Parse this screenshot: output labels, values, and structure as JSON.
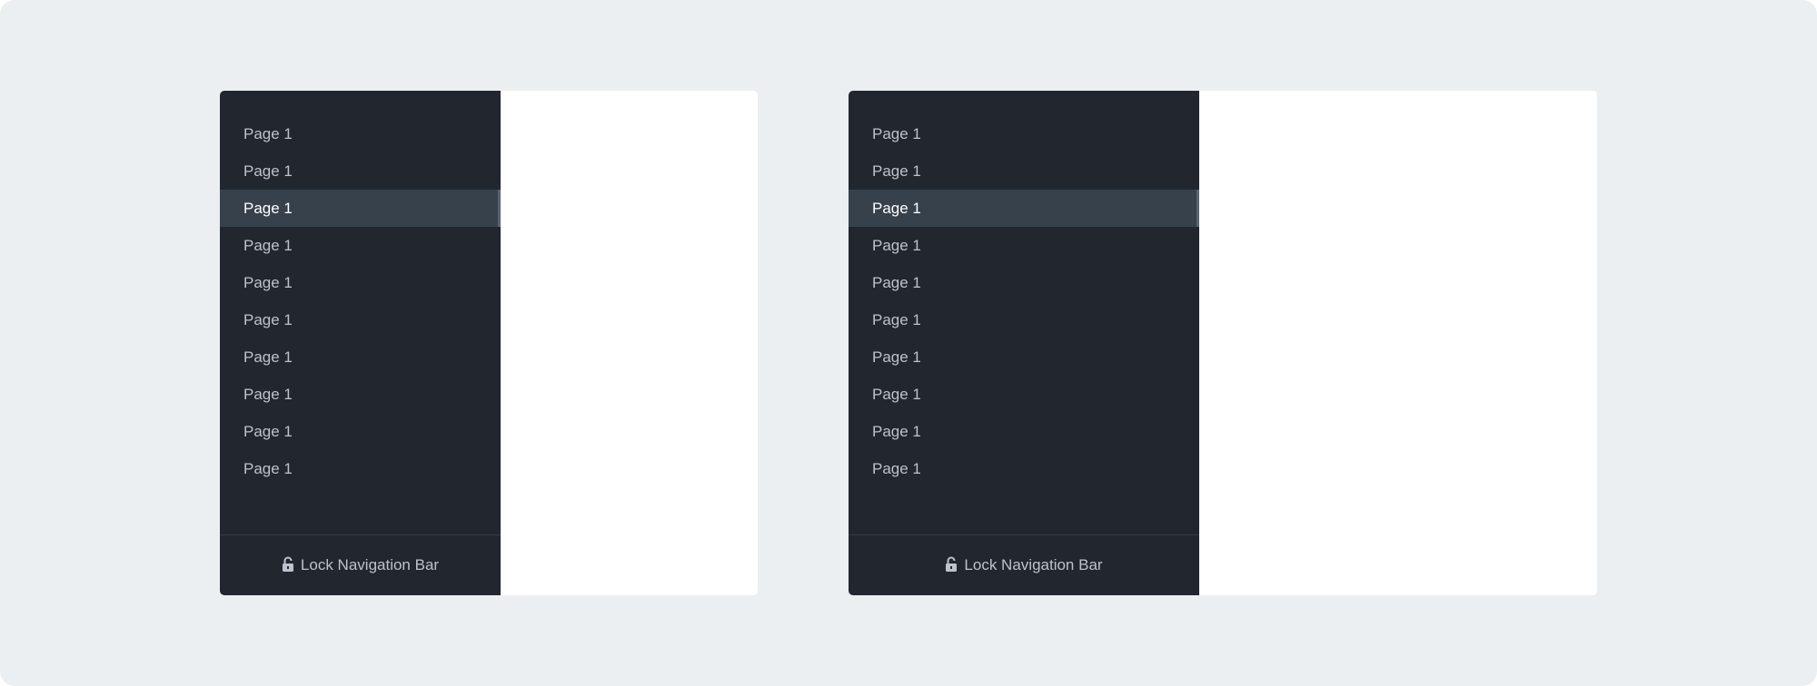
{
  "panels": [
    {
      "nav_items": [
        {
          "label": "Page 1"
        },
        {
          "label": "Page 1"
        },
        {
          "label": "Page 1",
          "active": true
        },
        {
          "label": "Page 1"
        },
        {
          "label": "Page 1"
        },
        {
          "label": "Page 1"
        },
        {
          "label": "Page 1"
        },
        {
          "label": "Page 1"
        },
        {
          "label": "Page 1"
        },
        {
          "label": "Page 1"
        }
      ],
      "footer": {
        "icon": "unlock-icon",
        "label": "Lock Navigation Bar"
      }
    },
    {
      "nav_items": [
        {
          "label": "Page 1"
        },
        {
          "label": "Page 1"
        },
        {
          "label": "Page 1",
          "active": true
        },
        {
          "label": "Page 1"
        },
        {
          "label": "Page 1"
        },
        {
          "label": "Page 1"
        },
        {
          "label": "Page 1"
        },
        {
          "label": "Page 1"
        },
        {
          "label": "Page 1"
        },
        {
          "label": "Page 1"
        }
      ],
      "footer": {
        "icon": "unlock-icon",
        "label": "Lock Navigation Bar"
      }
    }
  ],
  "colors": {
    "background": "#ECEFF2",
    "sidebar": "#22262E",
    "active_item": "#37414C",
    "text": "#BCC3CE",
    "active_text": "#FFFFFF",
    "content": "#FFFFFF"
  }
}
